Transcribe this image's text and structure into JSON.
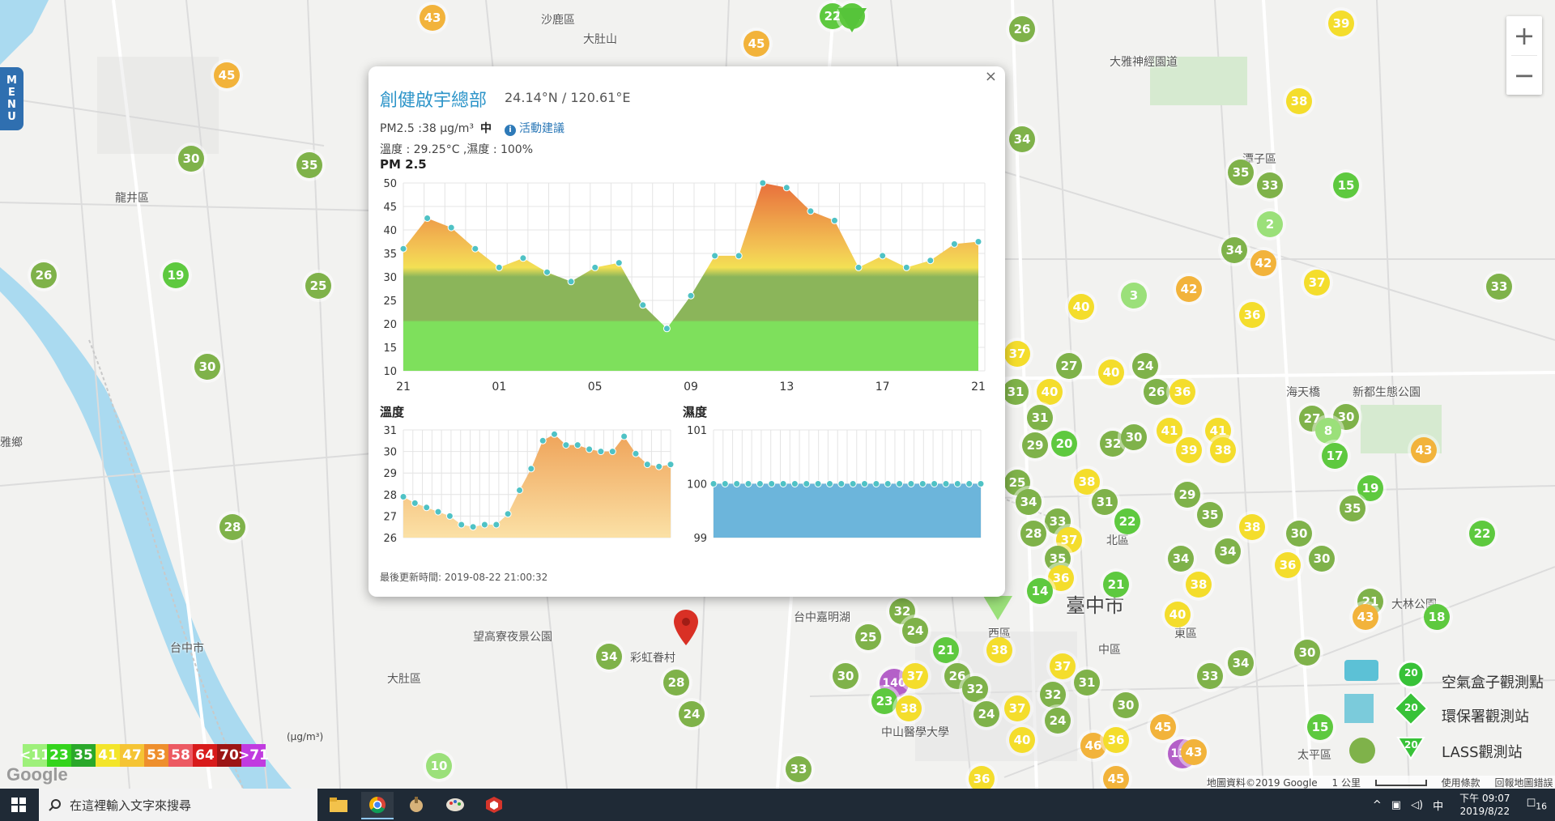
{
  "map": {
    "places": [
      {
        "name": "沙鹿區",
        "x": 668,
        "y": 14,
        "big": false
      },
      {
        "name": "大肚山",
        "x": 720,
        "y": 38,
        "big": false
      },
      {
        "name": "龍井區",
        "x": 142,
        "y": 234,
        "big": false
      },
      {
        "name": "大肚區",
        "x": 478,
        "y": 828,
        "big": false
      },
      {
        "name": "望高寮夜景公園",
        "x": 584,
        "y": 776,
        "big": false
      },
      {
        "name": "彩虹眷村",
        "x": 778,
        "y": 802,
        "big": false
      },
      {
        "name": "台中嘉明湖",
        "x": 980,
        "y": 752,
        "big": false
      },
      {
        "name": "西區",
        "x": 1220,
        "y": 772,
        "big": false
      },
      {
        "name": "中區",
        "x": 1356,
        "y": 792,
        "big": false
      },
      {
        "name": "東區",
        "x": 1450,
        "y": 772,
        "big": false
      },
      {
        "name": "北區",
        "x": 1366,
        "y": 657,
        "big": false
      },
      {
        "name": "中山醫學大學",
        "x": 1088,
        "y": 894,
        "big": false
      },
      {
        "name": "潭子區",
        "x": 1534,
        "y": 186,
        "big": false
      },
      {
        "name": "海天橋",
        "x": 1588,
        "y": 474,
        "big": false
      },
      {
        "name": "新都生態公園",
        "x": 1670,
        "y": 474,
        "big": false
      },
      {
        "name": "太平區",
        "x": 1602,
        "y": 922,
        "big": false
      },
      {
        "name": "臺中市",
        "x": 1316,
        "y": 728,
        "big": true
      },
      {
        "name": "大林公園",
        "x": 1718,
        "y": 736,
        "big": false
      },
      {
        "name": "大雅神經園道",
        "x": 1370,
        "y": 66,
        "big": false
      },
      {
        "name": "雅鄉",
        "x": 0,
        "y": 536,
        "big": false
      },
      {
        "name": "台中市",
        "x": 210,
        "y": 790,
        "big": false
      }
    ],
    "markers": [
      {
        "v": "43",
        "x": 534,
        "y": 22,
        "c": "o"
      },
      {
        "v": "22",
        "x": 1028,
        "y": 20,
        "c": "g2"
      },
      {
        "v": "31",
        "x": 1052,
        "y": 20,
        "c": "g2"
      },
      {
        "v": "45",
        "x": 934,
        "y": 54,
        "c": "o"
      },
      {
        "v": "26",
        "x": 1262,
        "y": 36,
        "c": "g1"
      },
      {
        "v": "39",
        "x": 1656,
        "y": 29,
        "c": "y"
      },
      {
        "v": "45",
        "x": 280,
        "y": 93,
        "c": "o"
      },
      {
        "v": "38",
        "x": 1604,
        "y": 125,
        "c": "y"
      },
      {
        "v": "34",
        "x": 1262,
        "y": 172,
        "c": "g1"
      },
      {
        "v": "30",
        "x": 236,
        "y": 196,
        "c": "g1"
      },
      {
        "v": "35",
        "x": 382,
        "y": 204,
        "c": "g1"
      },
      {
        "v": "35",
        "x": 1532,
        "y": 213,
        "c": "g1"
      },
      {
        "v": "33",
        "x": 1568,
        "y": 229,
        "c": "g1"
      },
      {
        "v": "15",
        "x": 1662,
        "y": 229,
        "c": "g2"
      },
      {
        "v": "2",
        "x": 1568,
        "y": 277,
        "c": "g3"
      },
      {
        "v": "34",
        "x": 1524,
        "y": 309,
        "c": "g1"
      },
      {
        "v": "42",
        "x": 1560,
        "y": 325,
        "c": "o"
      },
      {
        "v": "26",
        "x": 54,
        "y": 340,
        "c": "g1"
      },
      {
        "v": "19",
        "x": 217,
        "y": 340,
        "c": "g2"
      },
      {
        "v": "25",
        "x": 393,
        "y": 353,
        "c": "g1"
      },
      {
        "v": "37",
        "x": 1626,
        "y": 349,
        "c": "y"
      },
      {
        "v": "33",
        "x": 1851,
        "y": 354,
        "c": "g1"
      },
      {
        "v": "3",
        "x": 1400,
        "y": 365,
        "c": "g3"
      },
      {
        "v": "42",
        "x": 1468,
        "y": 357,
        "c": "o"
      },
      {
        "v": "40",
        "x": 1335,
        "y": 379,
        "c": "y"
      },
      {
        "v": "36",
        "x": 1546,
        "y": 389,
        "c": "y"
      },
      {
        "v": "30",
        "x": 256,
        "y": 453,
        "c": "g1"
      },
      {
        "v": "37",
        "x": 1256,
        "y": 437,
        "c": "y"
      },
      {
        "v": "27",
        "x": 1320,
        "y": 452,
        "c": "g1"
      },
      {
        "v": "24",
        "x": 1414,
        "y": 452,
        "c": "g1"
      },
      {
        "v": "40",
        "x": 1372,
        "y": 460,
        "c": "y"
      },
      {
        "v": "31",
        "x": 1254,
        "y": 484,
        "c": "g1"
      },
      {
        "v": "40",
        "x": 1296,
        "y": 484,
        "c": "y"
      },
      {
        "v": "26",
        "x": 1428,
        "y": 484,
        "c": "g1"
      },
      {
        "v": "36",
        "x": 1460,
        "y": 484,
        "c": "y"
      },
      {
        "v": "31",
        "x": 1284,
        "y": 516,
        "c": "g1"
      },
      {
        "v": "27",
        "x": 1620,
        "y": 517,
        "c": "g1"
      },
      {
        "v": "30",
        "x": 1662,
        "y": 515,
        "c": "g1"
      },
      {
        "v": "41",
        "x": 1444,
        "y": 532,
        "c": "y"
      },
      {
        "v": "41",
        "x": 1504,
        "y": 532,
        "c": "y"
      },
      {
        "v": "8",
        "x": 1640,
        "y": 532,
        "c": "g3"
      },
      {
        "v": "29",
        "x": 1278,
        "y": 550,
        "c": "g1"
      },
      {
        "v": "20",
        "x": 1314,
        "y": 548,
        "c": "g2"
      },
      {
        "v": "32",
        "x": 1374,
        "y": 548,
        "c": "g1"
      },
      {
        "v": "30",
        "x": 1400,
        "y": 540,
        "c": "g1"
      },
      {
        "v": "39",
        "x": 1468,
        "y": 556,
        "c": "y"
      },
      {
        "v": "38",
        "x": 1510,
        "y": 556,
        "c": "y"
      },
      {
        "v": "43",
        "x": 1758,
        "y": 556,
        "c": "o"
      },
      {
        "v": "17",
        "x": 1648,
        "y": 563,
        "c": "g2"
      },
      {
        "v": "25",
        "x": 1256,
        "y": 596,
        "c": "g1"
      },
      {
        "v": "38",
        "x": 1342,
        "y": 595,
        "c": "y"
      },
      {
        "v": "19",
        "x": 1692,
        "y": 603,
        "c": "g2"
      },
      {
        "v": "29",
        "x": 1466,
        "y": 611,
        "c": "g1"
      },
      {
        "v": "34",
        "x": 1270,
        "y": 620,
        "c": "g1"
      },
      {
        "v": "31",
        "x": 1364,
        "y": 620,
        "c": "g1"
      },
      {
        "v": "35",
        "x": 1670,
        "y": 628,
        "c": "g1"
      },
      {
        "v": "35",
        "x": 1494,
        "y": 636,
        "c": "g1"
      },
      {
        "v": "33",
        "x": 1306,
        "y": 644,
        "c": "g1"
      },
      {
        "v": "22",
        "x": 1392,
        "y": 644,
        "c": "g2"
      },
      {
        "v": "38",
        "x": 1546,
        "y": 651,
        "c": "y"
      },
      {
        "v": "28",
        "x": 287,
        "y": 651,
        "c": "g1"
      },
      {
        "v": "28",
        "x": 1276,
        "y": 659,
        "c": "g1"
      },
      {
        "v": "37",
        "x": 1320,
        "y": 667,
        "c": "y"
      },
      {
        "v": "30",
        "x": 1604,
        "y": 659,
        "c": "g1"
      },
      {
        "v": "22",
        "x": 1830,
        "y": 659,
        "c": "g2"
      },
      {
        "v": "34",
        "x": 1516,
        "y": 681,
        "c": "g1"
      },
      {
        "v": "35",
        "x": 1306,
        "y": 690,
        "c": "g1"
      },
      {
        "v": "34",
        "x": 1458,
        "y": 690,
        "c": "g1"
      },
      {
        "v": "30",
        "x": 1632,
        "y": 690,
        "c": "g1"
      },
      {
        "v": "36",
        "x": 1590,
        "y": 698,
        "c": "y"
      },
      {
        "v": "36",
        "x": 1310,
        "y": 714,
        "c": "y"
      },
      {
        "v": "21",
        "x": 1378,
        "y": 722,
        "c": "g2"
      },
      {
        "v": "38",
        "x": 1480,
        "y": 722,
        "c": "y"
      },
      {
        "v": "14",
        "x": 1284,
        "y": 730,
        "c": "g2"
      },
      {
        "v": "21",
        "x": 1692,
        "y": 743,
        "c": "g1"
      },
      {
        "v": "32",
        "x": 1114,
        "y": 755,
        "c": "g1"
      },
      {
        "v": "40",
        "x": 1454,
        "y": 759,
        "c": "y"
      },
      {
        "v": "18",
        "x": 1774,
        "y": 762,
        "c": "g2"
      },
      {
        "v": "43",
        "x": 1686,
        "y": 762,
        "c": "o"
      },
      {
        "v": "24",
        "x": 1130,
        "y": 779,
        "c": "g1"
      },
      {
        "v": "25",
        "x": 1072,
        "y": 787,
        "c": "g1"
      },
      {
        "v": "34",
        "x": 752,
        "y": 811,
        "c": "g1"
      },
      {
        "v": "38",
        "x": 1234,
        "y": 803,
        "c": "y"
      },
      {
        "v": "21",
        "x": 1168,
        "y": 803,
        "c": "g2"
      },
      {
        "v": "34",
        "x": 1532,
        "y": 819,
        "c": "g1"
      },
      {
        "v": "37",
        "x": 1312,
        "y": 823,
        "c": "y"
      },
      {
        "v": "30",
        "x": 1614,
        "y": 806,
        "c": "g1"
      },
      {
        "v": "30",
        "x": 1044,
        "y": 835,
        "c": "g1"
      },
      {
        "v": "140",
        "x": 1102,
        "y": 842,
        "c": "p"
      },
      {
        "v": "37",
        "x": 1130,
        "y": 835,
        "c": "y"
      },
      {
        "v": "26",
        "x": 1182,
        "y": 835,
        "c": "g1"
      },
      {
        "v": "32",
        "x": 1204,
        "y": 851,
        "c": "g1"
      },
      {
        "v": "31",
        "x": 1342,
        "y": 843,
        "c": "g1"
      },
      {
        "v": "33",
        "x": 1494,
        "y": 835,
        "c": "g1"
      },
      {
        "v": "28",
        "x": 835,
        "y": 843,
        "c": "g1"
      },
      {
        "v": "32",
        "x": 1300,
        "y": 858,
        "c": "g1"
      },
      {
        "v": "23",
        "x": 1092,
        "y": 866,
        "c": "g2"
      },
      {
        "v": "38",
        "x": 1122,
        "y": 875,
        "c": "y"
      },
      {
        "v": "37",
        "x": 1256,
        "y": 875,
        "c": "y"
      },
      {
        "v": "30",
        "x": 1390,
        "y": 871,
        "c": "g1"
      },
      {
        "v": "24",
        "x": 854,
        "y": 882,
        "c": "g1"
      },
      {
        "v": "24",
        "x": 1218,
        "y": 882,
        "c": "g1"
      },
      {
        "v": "24",
        "x": 1306,
        "y": 890,
        "c": "g1"
      },
      {
        "v": "45",
        "x": 1436,
        "y": 898,
        "c": "o"
      },
      {
        "v": "40",
        "x": 1262,
        "y": 914,
        "c": "y"
      },
      {
        "v": "46",
        "x": 1350,
        "y": 921,
        "c": "o"
      },
      {
        "v": "36",
        "x": 1378,
        "y": 914,
        "c": "y"
      },
      {
        "v": "130",
        "x": 1458,
        "y": 929,
        "c": "p"
      },
      {
        "v": "43",
        "x": 1474,
        "y": 929,
        "c": "o"
      },
      {
        "v": "15",
        "x": 1630,
        "y": 898,
        "c": "g2"
      },
      {
        "v": "10",
        "x": 542,
        "y": 946,
        "c": "g3"
      },
      {
        "v": "33",
        "x": 986,
        "y": 950,
        "c": "g1"
      },
      {
        "v": "36",
        "x": 1212,
        "y": 962,
        "c": "y"
      },
      {
        "v": "45",
        "x": 1378,
        "y": 962,
        "c": "o"
      }
    ]
  },
  "menu": {
    "label": [
      "M",
      "E",
      "N",
      "U"
    ]
  },
  "zoom": {
    "in": "+",
    "out": "−"
  },
  "popup": {
    "close": "×",
    "station": "創健啟宇總部",
    "coords": "24.14°N / 120.61°E",
    "pm_text": "PM2.5 :38 μg/m³",
    "pm_level": "中",
    "advice": "活動建議",
    "temp_hum": "溫度 : 29.25°C ,濕度 : 100%",
    "pm_title": "PM 2.5",
    "temp_title": "溫度",
    "hum_title": "濕度",
    "updated": "最後更新時間: 2019-08-22 21:00:32"
  },
  "chart_data": [
    {
      "type": "area",
      "title": "PM 2.5",
      "x_ticks": [
        "21",
        "01",
        "05",
        "09",
        "13",
        "17",
        "21"
      ],
      "ylim": [
        10,
        50
      ],
      "y_ticks": [
        10,
        15,
        20,
        25,
        30,
        35,
        40,
        45,
        50
      ],
      "values": [
        36,
        42.5,
        40.5,
        36,
        32,
        34,
        31,
        29,
        32,
        33,
        24,
        19,
        26,
        34.5,
        34.5,
        50,
        49,
        44,
        42,
        32,
        34.5,
        32,
        33.5,
        37,
        37.5
      ]
    },
    {
      "type": "area",
      "title": "溫度",
      "ylim": [
        26,
        31
      ],
      "y_ticks": [
        26,
        27,
        28,
        29,
        30,
        31
      ],
      "values": [
        27.9,
        27.6,
        27.4,
        27.2,
        27,
        26.6,
        26.5,
        26.6,
        26.6,
        27.1,
        28.2,
        29.2,
        30.5,
        30.8,
        30.3,
        30.3,
        30.1,
        30,
        30,
        30.7,
        29.9,
        29.4,
        29.3,
        29.4
      ]
    },
    {
      "type": "area",
      "title": "濕度",
      "ylim": [
        99,
        101
      ],
      "y_ticks": [
        99,
        100,
        101
      ],
      "values": [
        100,
        100,
        100,
        100,
        100,
        100,
        100,
        100,
        100,
        100,
        100,
        100,
        100,
        100,
        100,
        100,
        100,
        100,
        100,
        100,
        100,
        100,
        100,
        100
      ]
    }
  ],
  "legend": {
    "unit": "(μg/m³)",
    "cells": [
      {
        "label": "<11",
        "color": "#9ef07a"
      },
      {
        "label": "23",
        "color": "#34d41c"
      },
      {
        "label": "35",
        "color": "#2aa82a"
      },
      {
        "label": "41",
        "color": "#f3e52a"
      },
      {
        "label": "47",
        "color": "#f5c434"
      },
      {
        "label": "53",
        "color": "#ee8f2d"
      },
      {
        "label": "58",
        "color": "#ec5a62"
      },
      {
        "label": "64",
        "color": "#d81b1b"
      },
      {
        "label": "70",
        "color": "#9c1515"
      },
      {
        "label": ">71",
        "color": "#c13be0"
      }
    ]
  },
  "stations": {
    "airbox": "空氣盒子觀測點",
    "epa": "環保署觀測站",
    "lass": "LASS觀測站",
    "marker_value": "20"
  },
  "map_footer": {
    "data": "地圖資料©2019 Google",
    "scale": "1 公里",
    "terms": "使用條款",
    "report": "回報地圖錯誤"
  },
  "google_logo": "Google",
  "taskbar": {
    "search_placeholder": "在這裡輸入文字來搜尋",
    "time": "下午 09:07",
    "date": "2019/8/22",
    "ime": "中",
    "notif": "16"
  }
}
